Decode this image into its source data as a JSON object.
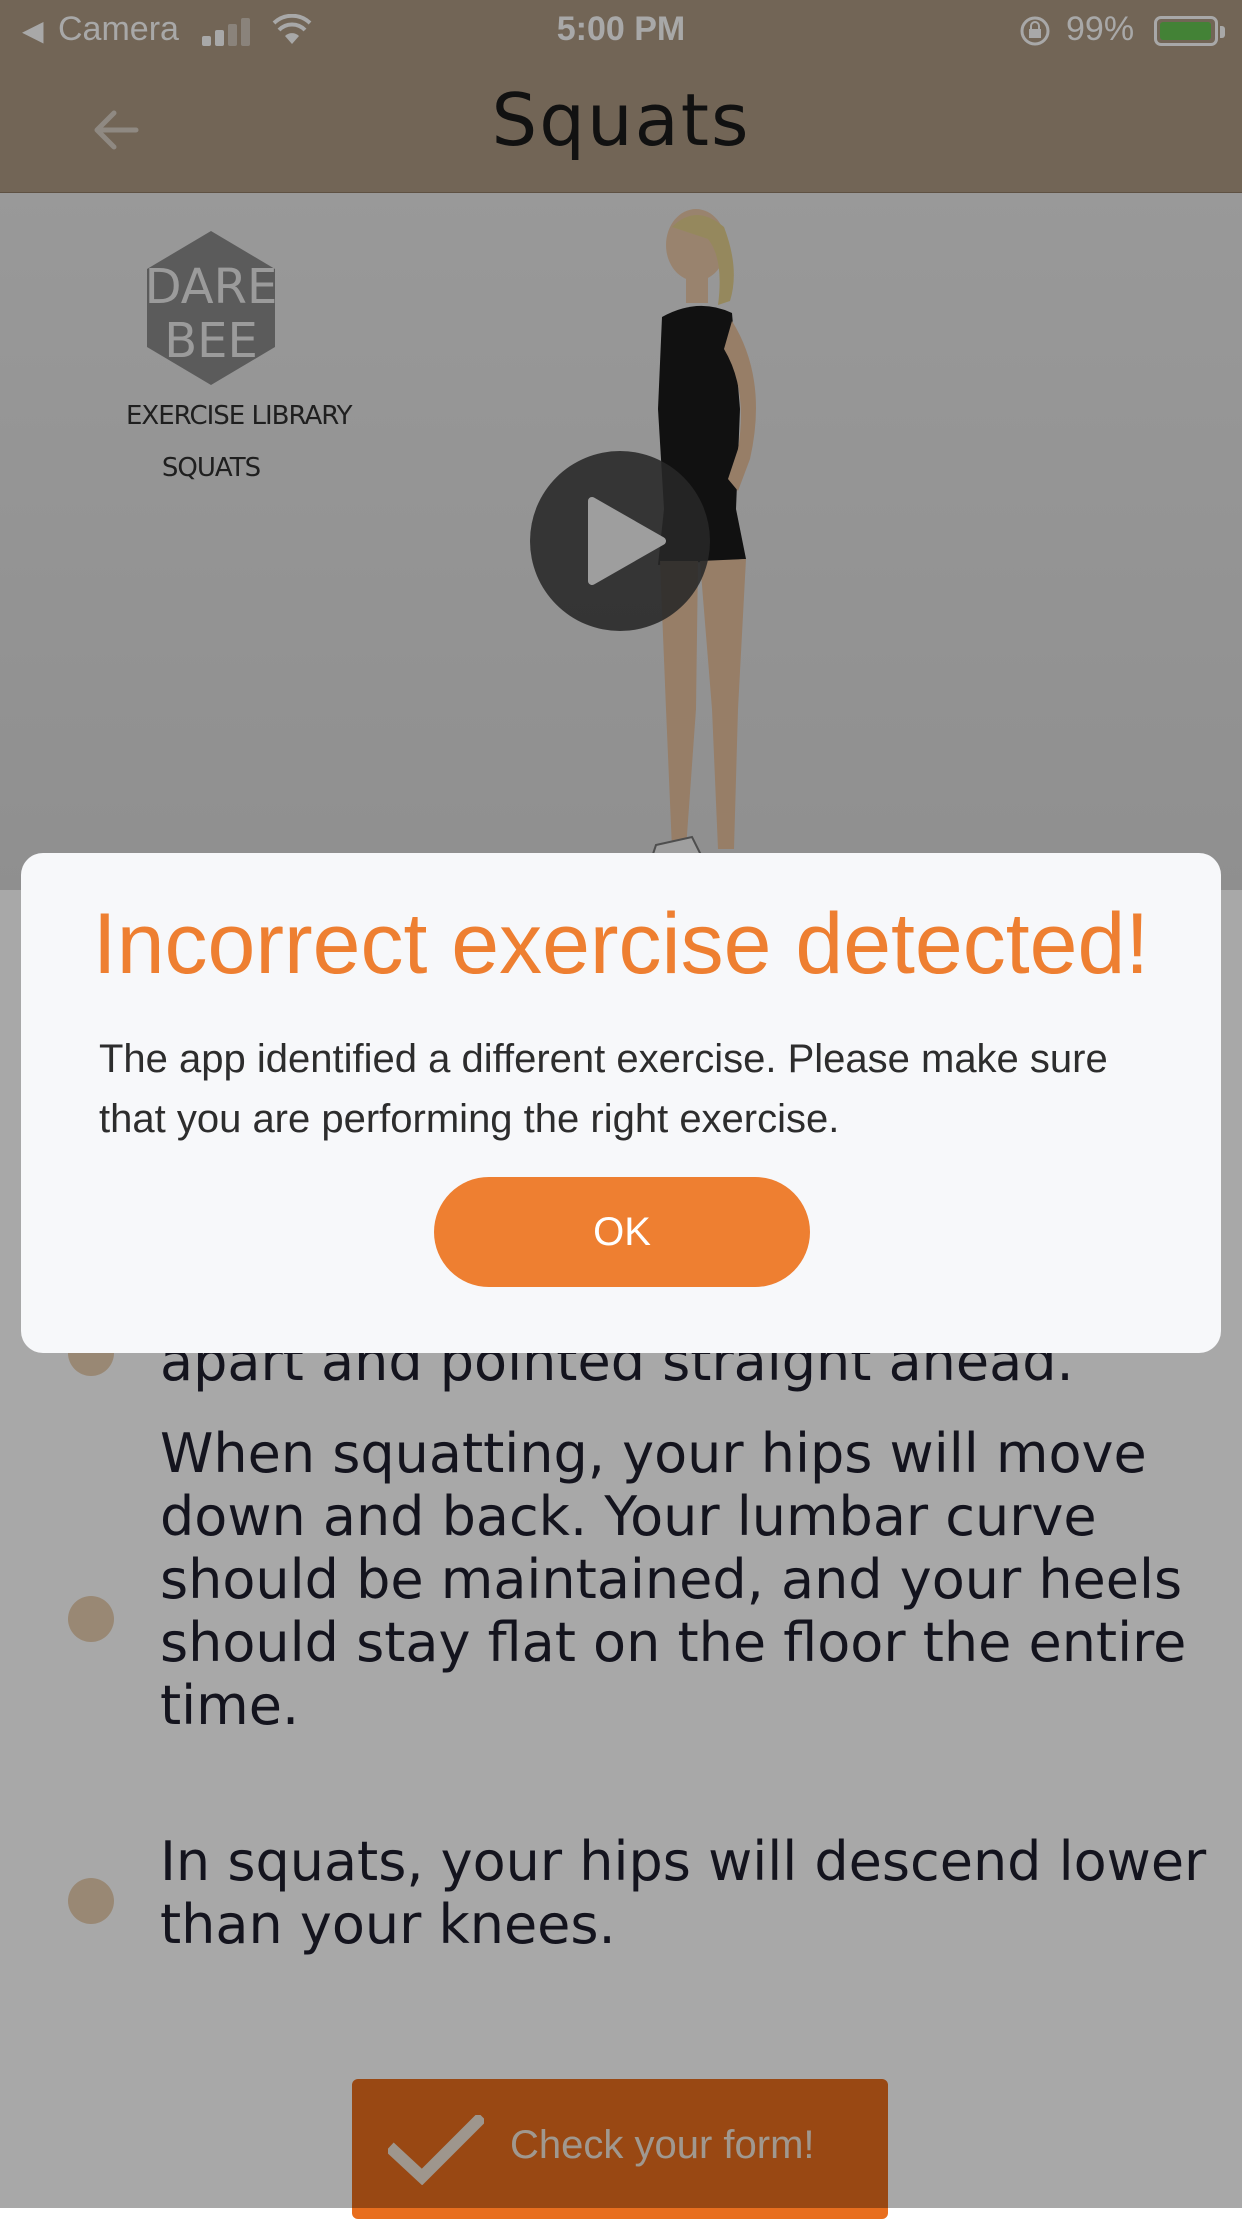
{
  "status_bar": {
    "back_app": "Camera",
    "time": "5:00 PM",
    "battery": "99%",
    "battery_level": 0.99,
    "battery_color": "#67c652"
  },
  "nav": {
    "back_icon": "arrow-left-icon",
    "title": "Squats"
  },
  "video": {
    "logo_line1": "DARE",
    "logo_line2": "BEE",
    "logo_subtitle": "EXERCISE LIBRARY",
    "logo_exercise": "SQUATS",
    "play_icon": "play-icon"
  },
  "instructions": [
    "apart and pointed straight ahead.",
    "When squatting, your hips will move down and back. Your lumbar curve should be maintained, and your heels should stay flat on the floor the entire time.",
    "In squats, your hips will descend lower than your knees."
  ],
  "check_form": {
    "label": "Check your form!",
    "icon": "checkmark-icon"
  },
  "dialog": {
    "title": "Incorrect exercise detected!",
    "message": "The app identified a different exercise. Please make sure that you are performing the right exercise.",
    "ok_label": "OK"
  },
  "colors": {
    "header": "#ae9a83",
    "accent": "#ee7f31",
    "bullet": "#e8cfb0"
  }
}
